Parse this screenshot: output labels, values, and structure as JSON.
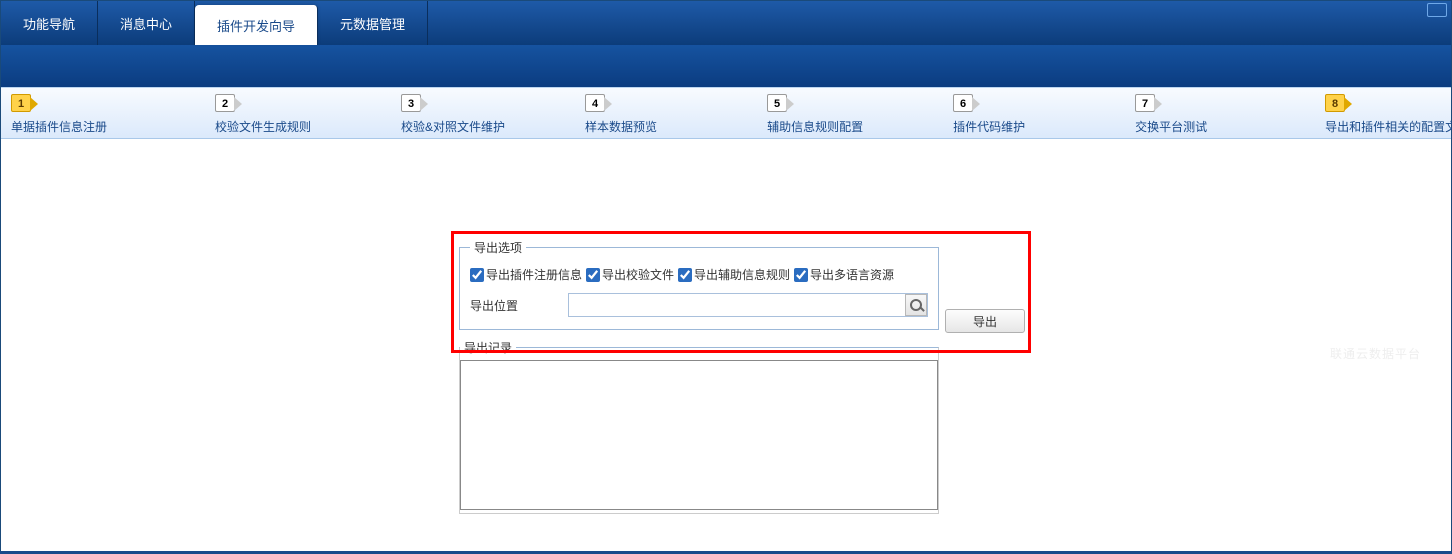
{
  "nav": {
    "tabs": [
      {
        "label": "功能导航"
      },
      {
        "label": "消息中心"
      },
      {
        "label": "插件开发向导"
      },
      {
        "label": "元数据管理"
      }
    ],
    "active_index": 2
  },
  "wizard": {
    "steps": [
      {
        "num": "1",
        "label": "单据插件信息注册"
      },
      {
        "num": "2",
        "label": "校验文件生成规则"
      },
      {
        "num": "3",
        "label": "校验&对照文件维护"
      },
      {
        "num": "4",
        "label": "样本数据预览"
      },
      {
        "num": "5",
        "label": "辅助信息规则配置"
      },
      {
        "num": "6",
        "label": "插件代码维护"
      },
      {
        "num": "7",
        "label": "交换平台测试"
      },
      {
        "num": "8",
        "label": "导出和插件相关的配置文"
      }
    ],
    "active_index": 7
  },
  "export": {
    "options_legend": "导出选项",
    "chk1_label": "导出插件注册信息",
    "chk2_label": "导出校验文件",
    "chk3_label": "导出辅助信息规则",
    "chk4_label": "导出多语言资源",
    "location_label": "导出位置",
    "location_value": "",
    "export_btn": "导出",
    "log_legend": "导出记录",
    "log_value": ""
  },
  "watermark": "联通云数据平台"
}
